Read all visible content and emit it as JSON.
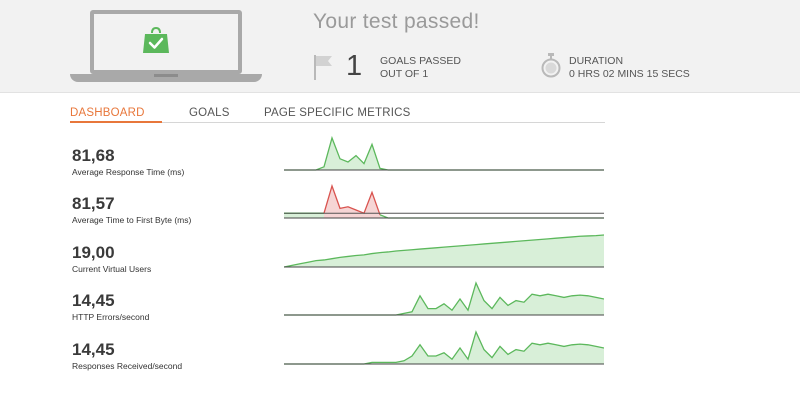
{
  "header": {
    "result_title": "Your test passed!",
    "goals": {
      "count": "1",
      "line1": "GOALS PASSED",
      "line2": "OUT OF 1"
    },
    "duration": {
      "title": "DURATION",
      "value": "0 HRS  02 MINS  15 SECS"
    },
    "icons": {
      "laptop": "laptop-icon",
      "badge": "shopping-bag-check-icon",
      "flag": "flag-icon",
      "duration": "stopwatch-icon"
    },
    "colors": {
      "success_green": "#5cb85c"
    }
  },
  "tabs": [
    {
      "label": "DASHBOARD",
      "active": true
    },
    {
      "label": "GOALS",
      "active": false
    },
    {
      "label": "PAGE SPECIFIC METRICS",
      "active": false
    }
  ],
  "metrics": [
    {
      "value": "81,68",
      "label": "Average Response Time (ms)",
      "color": "green",
      "series": [
        0,
        0,
        0,
        0,
        0,
        0.1,
        1,
        0.35,
        0.25,
        0.45,
        0.2,
        0.8,
        0.05,
        0,
        0,
        0,
        0,
        0,
        0,
        0,
        0,
        0,
        0,
        0,
        0,
        0,
        0,
        0,
        0,
        0,
        0,
        0,
        0,
        0,
        0,
        0,
        0,
        0,
        0,
        0,
        0
      ]
    },
    {
      "value": "81,57",
      "label": "Average Time to First Byte (ms)",
      "color": "mixed",
      "series": [
        0.15,
        0.15,
        0.15,
        0.15,
        0.15,
        0.15,
        1,
        0.3,
        0.35,
        0.25,
        0.15,
        0.8,
        0.1,
        0,
        0,
        0,
        0,
        0,
        0,
        0,
        0,
        0,
        0,
        0,
        0,
        0,
        0,
        0,
        0,
        0,
        0,
        0,
        0,
        0,
        0,
        0,
        0,
        0,
        0,
        0,
        0
      ]
    },
    {
      "value": "19,00",
      "label": "Current Virtual Users",
      "color": "green",
      "series": [
        0,
        0.05,
        0.1,
        0.15,
        0.2,
        0.22,
        0.26,
        0.3,
        0.33,
        0.36,
        0.38,
        0.42,
        0.45,
        0.47,
        0.5,
        0.52,
        0.54,
        0.56,
        0.58,
        0.6,
        0.62,
        0.64,
        0.66,
        0.68,
        0.7,
        0.72,
        0.74,
        0.76,
        0.78,
        0.8,
        0.82,
        0.84,
        0.86,
        0.88,
        0.9,
        0.92,
        0.94,
        0.96,
        0.97,
        0.98,
        1
      ]
    },
    {
      "value": "14,45",
      "label": "HTTP Errors/second",
      "color": "green",
      "series": [
        0,
        0,
        0,
        0,
        0,
        0,
        0,
        0,
        0,
        0,
        0,
        0,
        0,
        0,
        0,
        0.05,
        0.1,
        0.6,
        0.2,
        0.2,
        0.35,
        0.15,
        0.5,
        0.15,
        1,
        0.45,
        0.2,
        0.55,
        0.3,
        0.45,
        0.4,
        0.65,
        0.6,
        0.65,
        0.6,
        0.55,
        0.6,
        0.62,
        0.6,
        0.55,
        0.5
      ]
    },
    {
      "value": "14,45",
      "label": "Responses Received/second",
      "color": "green",
      "series": [
        0,
        0,
        0,
        0,
        0,
        0,
        0,
        0,
        0,
        0,
        0,
        0.05,
        0.05,
        0.05,
        0.05,
        0.1,
        0.25,
        0.6,
        0.25,
        0.25,
        0.35,
        0.15,
        0.5,
        0.15,
        1,
        0.45,
        0.2,
        0.55,
        0.3,
        0.45,
        0.4,
        0.65,
        0.6,
        0.65,
        0.6,
        0.55,
        0.6,
        0.62,
        0.6,
        0.55,
        0.5
      ]
    }
  ]
}
